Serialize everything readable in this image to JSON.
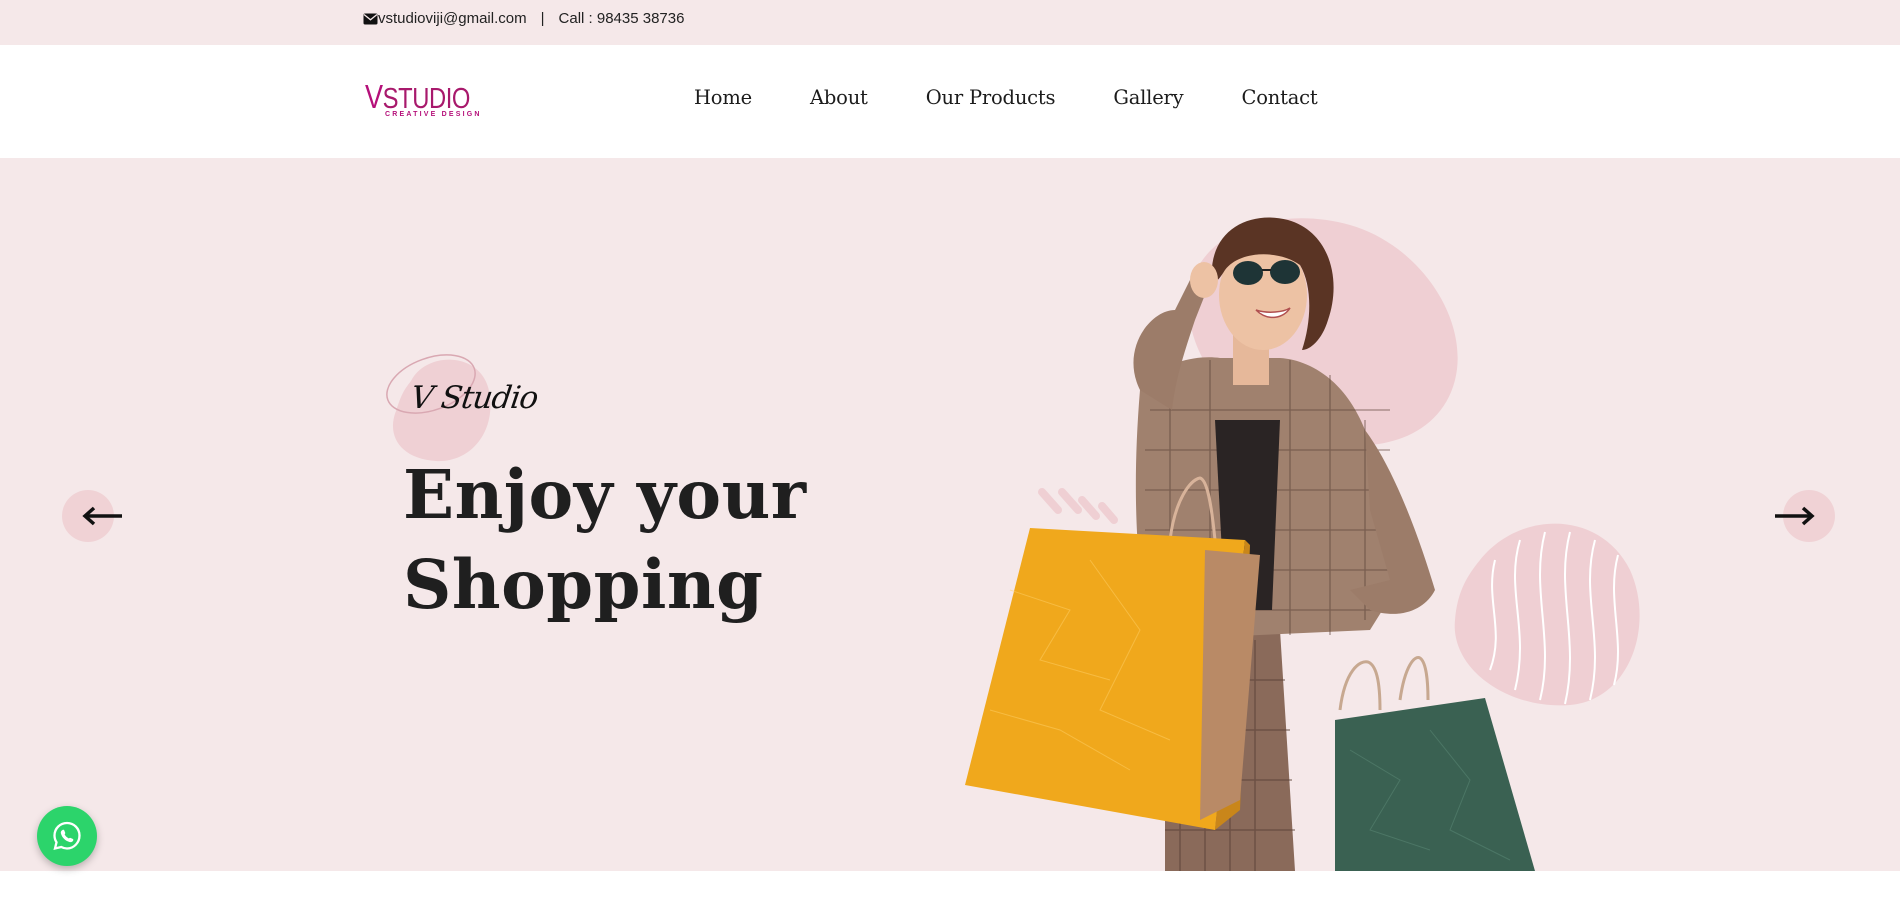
{
  "topbar": {
    "email": "vstudioviji@gmail.com",
    "separator": "|",
    "phone": "Call : 98435 38736"
  },
  "brand": {
    "logo_main": "STUDIO",
    "logo_v": "V",
    "logo_tagline": "CREATIVE DESIGN",
    "color": "#b5107a"
  },
  "nav": {
    "items": [
      "Home",
      "About",
      "Our Products",
      "Gallery",
      "Contact"
    ]
  },
  "hero": {
    "eyebrow": "V Studio",
    "headline_line1": "Enjoy your",
    "headline_line2": "Shopping",
    "background": "#f5e8e9"
  },
  "icons": {
    "email": "envelope-icon",
    "prev": "arrow-left-icon",
    "next": "arrow-right-icon",
    "chat": "whatsapp-icon"
  },
  "colors": {
    "whatsapp": "#2cd46b",
    "arrow_bg": "#f0d2d5"
  }
}
